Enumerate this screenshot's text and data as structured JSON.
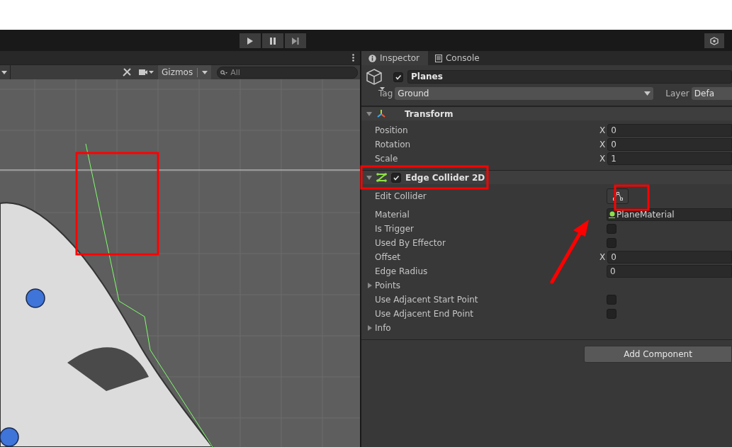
{
  "toolbar": {
    "controls": [
      {
        "kind": "play"
      },
      {
        "kind": "pause"
      },
      {
        "kind": "step"
      }
    ]
  },
  "scene": {
    "gizmos": "Gizmos",
    "search_placeholder": "All"
  },
  "inspector": {
    "tabs": [
      {
        "label": "Inspector",
        "kind": "info",
        "selected": true
      },
      {
        "label": "Console",
        "kind": "console",
        "selected": false
      }
    ],
    "object": {
      "active": true,
      "name": "Planes",
      "tag_label": "Tag",
      "tag": "Ground",
      "layer_label": "Layer",
      "layer": "Defa"
    },
    "components": [
      {
        "title": "Transform",
        "kind": "transform",
        "expanded": true,
        "fields": [
          {
            "label": "Position",
            "kind": "vector",
            "axis": "X",
            "value": "0"
          },
          {
            "label": "Rotation",
            "kind": "vector",
            "axis": "X",
            "value": "0"
          },
          {
            "label": "Scale",
            "kind": "vector",
            "axis": "X",
            "value": "1"
          }
        ]
      },
      {
        "title": "Edge Collider 2D",
        "kind": "edge",
        "enabled": true,
        "expanded": true,
        "fields": [
          {
            "label": "Edit Collider",
            "kind": "edit"
          },
          {
            "label": "Material",
            "kind": "object",
            "value": "PlaneMaterial"
          },
          {
            "label": "Is Trigger",
            "kind": "checkbox",
            "checked": false
          },
          {
            "label": "Used By Effector",
            "kind": "checkbox",
            "checked": false
          },
          {
            "label": "Offset",
            "kind": "vector",
            "axis": "X",
            "value": "0"
          },
          {
            "label": "Edge Radius",
            "kind": "number",
            "value": "0"
          },
          {
            "label": "Points",
            "kind": "foldout",
            "expanded": false
          },
          {
            "label": "Use Adjacent Start Point",
            "kind": "checkbox",
            "checked": false
          },
          {
            "label": "Use Adjacent End Point",
            "kind": "checkbox",
            "checked": false
          },
          {
            "label": "Info",
            "kind": "foldout",
            "expanded": false
          }
        ]
      }
    ],
    "add_component": "Add Component"
  }
}
